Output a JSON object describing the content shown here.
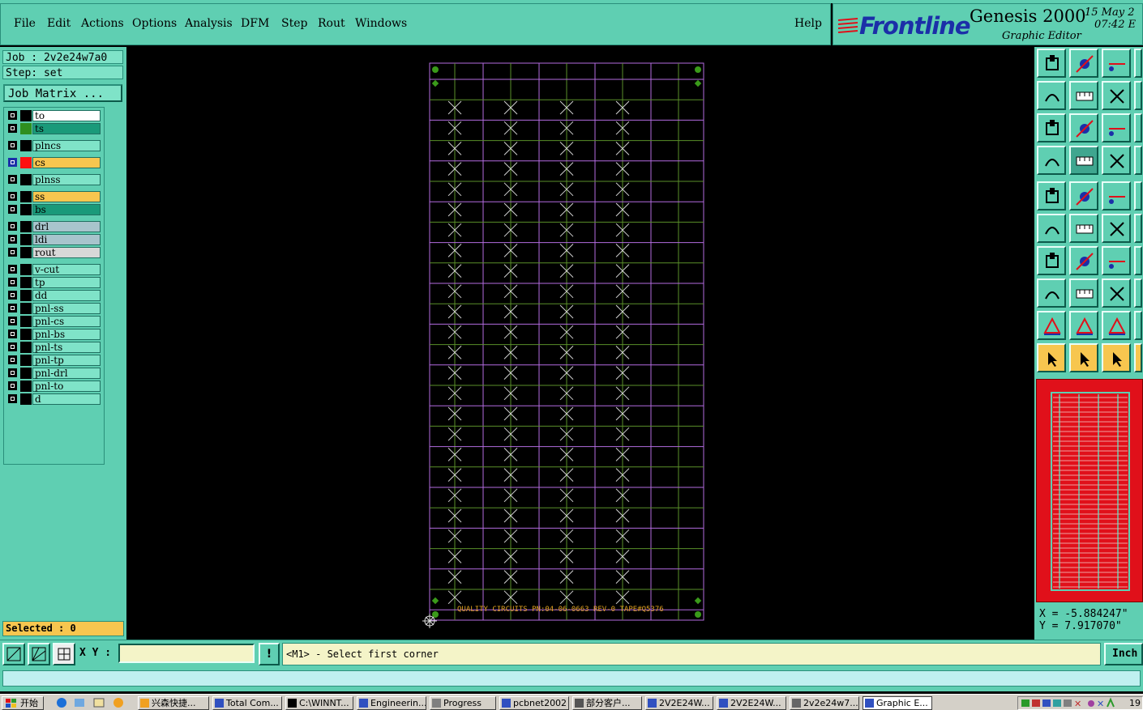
{
  "menu": {
    "items": [
      "File",
      "Edit",
      "Actions",
      "Options",
      "Analysis",
      "DFM",
      "Step",
      "Rout",
      "Windows"
    ],
    "help": "Help"
  },
  "brand": {
    "logo": "Frontline",
    "product": "Genesis 2000",
    "subtitle": "Graphic Editor",
    "date": "15 May 2",
    "time": "07:42 E"
  },
  "job": {
    "job_label": "Job : 2v2e24w7a0",
    "step_label": "Step: set",
    "matrix_button": "Job Matrix ..."
  },
  "layers": [
    {
      "name": "to",
      "color": "#000000",
      "bg": "#ffffff"
    },
    {
      "name": "ts",
      "color": "#2f8f1f",
      "bg": "#1a9a7a"
    },
    {
      "name": "plncs",
      "color": "#000000",
      "bg": "#7fe3c8"
    },
    {
      "name": "cs",
      "color": "#ff1010",
      "bg": "#f7c64f",
      "active": true
    },
    {
      "name": "plnss",
      "color": "#000000",
      "bg": "#7fe3c8"
    },
    {
      "name": "ss",
      "color": "#000000",
      "bg": "#f7c64f"
    },
    {
      "name": "bs",
      "color": "#000000",
      "bg": "#1a9a7a"
    },
    {
      "name": "drl",
      "color": "#000000",
      "bg": "#a8c4cc"
    },
    {
      "name": "ldi",
      "color": "#000000",
      "bg": "#a8c4cc"
    },
    {
      "name": "rout",
      "color": "#000000",
      "bg": "#d8d8d8"
    },
    {
      "name": "v-cut",
      "color": "#000000",
      "bg": "#7fe3c8"
    },
    {
      "name": "tp",
      "color": "#000000",
      "bg": "#7fe3c8"
    },
    {
      "name": "dd",
      "color": "#000000",
      "bg": "#7fe3c8"
    },
    {
      "name": "pnl-ss",
      "color": "#000000",
      "bg": "#7fe3c8"
    },
    {
      "name": "pnl-cs",
      "color": "#000000",
      "bg": "#7fe3c8"
    },
    {
      "name": "pnl-bs",
      "color": "#000000",
      "bg": "#7fe3c8"
    },
    {
      "name": "pnl-ts",
      "color": "#000000",
      "bg": "#7fe3c8"
    },
    {
      "name": "pnl-tp",
      "color": "#000000",
      "bg": "#7fe3c8"
    },
    {
      "name": "pnl-drl",
      "color": "#000000",
      "bg": "#7fe3c8"
    },
    {
      "name": "pnl-to",
      "color": "#000000",
      "bg": "#7fe3c8"
    },
    {
      "name": "d",
      "color": "#000000",
      "bg": "#7fe3c8"
    }
  ],
  "selected": "Selected : 0",
  "board_text": "QUALITY CIRCUITS PN:04-06-0663  REV-0  TAPE#Q5376",
  "coords": {
    "x": "X = -5.884247\"",
    "y": "Y = 7.917070\""
  },
  "xy_label": "X Y :",
  "xy_value": "",
  "excl": "!",
  "prompt": "<M1> - Select first corner",
  "units": "Inch",
  "taskbar": {
    "start": "开始",
    "tasks": [
      "兴森快捷...",
      "Total Com...",
      "C:\\WINNT...",
      "Engineerin...",
      "Progress",
      "pcbnet2002",
      "部分客户...",
      "2V2E24W...",
      "2V2E24W...",
      "2v2e24w7...",
      "Graphic E..."
    ],
    "clock": "19"
  },
  "colors": {
    "panel": "#5fcfb2",
    "highlight": "#f7c64f",
    "grid_purple": "#b36be0",
    "grid_green": "#5a8f2a",
    "pad_green": "#3a9a1a",
    "cross": "#d0d0d0"
  }
}
